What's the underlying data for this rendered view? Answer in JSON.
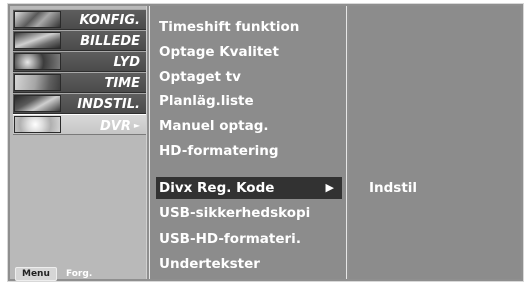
{
  "categories": [
    {
      "label": "KONFIG.",
      "thumb": "antenna-thumb",
      "selected": false
    },
    {
      "label": "BILLEDE",
      "thumb": "picture-thumb",
      "selected": false
    },
    {
      "label": "LYD",
      "thumb": "speaker-thumb",
      "selected": false
    },
    {
      "label": "TIME",
      "thumb": "clock-thumb",
      "selected": false
    },
    {
      "label": "INDSTIL.",
      "thumb": "option-thumb",
      "selected": false
    },
    {
      "label": "DVR",
      "thumb": "disc-thumb",
      "selected": true
    }
  ],
  "menu_hint": {
    "key": "Menu",
    "text": "Forg."
  },
  "submenu": {
    "items": [
      "Timeshift funktion",
      "Optage Kvalitet",
      "Optaget tv",
      "Planläg.liste",
      "Manuel optag.",
      "HD-formatering",
      "Divx Reg. Kode",
      "USB-sikkerhedskopi",
      "USB-HD-formateri.",
      "Undertekster"
    ],
    "highlighted_index": 6
  },
  "option": {
    "label": "Indstil"
  },
  "colors": {
    "panel": "#8c8c8c",
    "highlight": "#323232",
    "sidebar": "#b9b9b9",
    "text": "#ffffff"
  }
}
